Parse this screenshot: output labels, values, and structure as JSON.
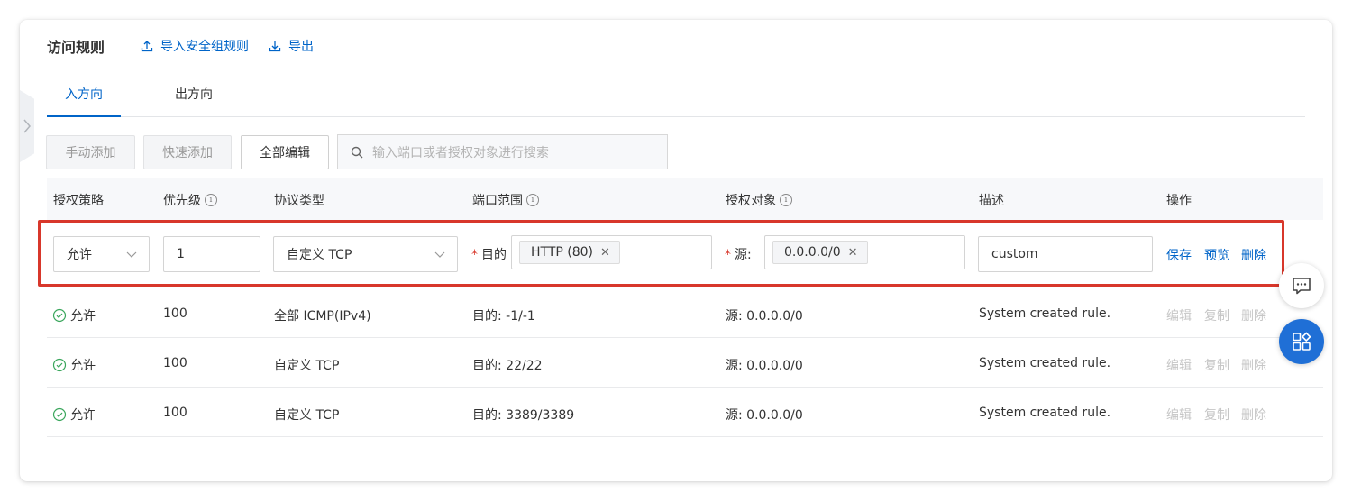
{
  "header": {
    "title": "访问规则",
    "import_label": "导入安全组规则",
    "export_label": "导出"
  },
  "tabs": [
    {
      "label": "入方向",
      "active": true
    },
    {
      "label": "出方向",
      "active": false
    }
  ],
  "toolbar": {
    "manual_add_label": "手动添加",
    "quick_add_label": "快速添加",
    "edit_all_label": "全部编辑",
    "search_placeholder": "输入端口或者授权对象进行搜索"
  },
  "columns": {
    "policy": "授权策略",
    "priority": "优先级",
    "protocol": "协议类型",
    "port_range": "端口范围",
    "auth_object": "授权对象",
    "description": "描述",
    "actions": "操作"
  },
  "edit_row": {
    "policy": "允许",
    "priority": "1",
    "protocol": "自定义 TCP",
    "port_label": "目的",
    "port_tag": "HTTP (80)",
    "source_label": "源:",
    "source_tag": "0.0.0.0/0",
    "description": "custom",
    "save_label": "保存",
    "preview_label": "预览",
    "delete_label": "删除"
  },
  "rows": [
    {
      "policy": "允许",
      "priority": "100",
      "protocol": "全部 ICMP(IPv4)",
      "port": "目的: -1/-1",
      "source": "源: 0.0.0.0/0",
      "description": "System created rule.",
      "edit": "编辑",
      "copy": "复制",
      "delete": "删除"
    },
    {
      "policy": "允许",
      "priority": "100",
      "protocol": "自定义 TCP",
      "port": "目的: 22/22",
      "source": "源: 0.0.0.0/0",
      "description": "System created rule.",
      "edit": "编辑",
      "copy": "复制",
      "delete": "删除"
    },
    {
      "policy": "允许",
      "priority": "100",
      "protocol": "自定义 TCP",
      "port": "目的: 3389/3389",
      "source": "源: 0.0.0.0/0",
      "description": "System created rule.",
      "edit": "编辑",
      "copy": "复制",
      "delete": "删除"
    }
  ],
  "colors": {
    "accent": "#0064c8",
    "highlight_border": "#d8372b",
    "allow_icon": "#3aa65c",
    "fab": "#1f6fd6"
  },
  "icons": [
    "upload-icon",
    "download-icon",
    "search-icon",
    "info-icon",
    "chevron-down-icon",
    "close-icon",
    "check-circle-icon",
    "chat-icon",
    "apps-icon",
    "chevron-right-icon"
  ]
}
